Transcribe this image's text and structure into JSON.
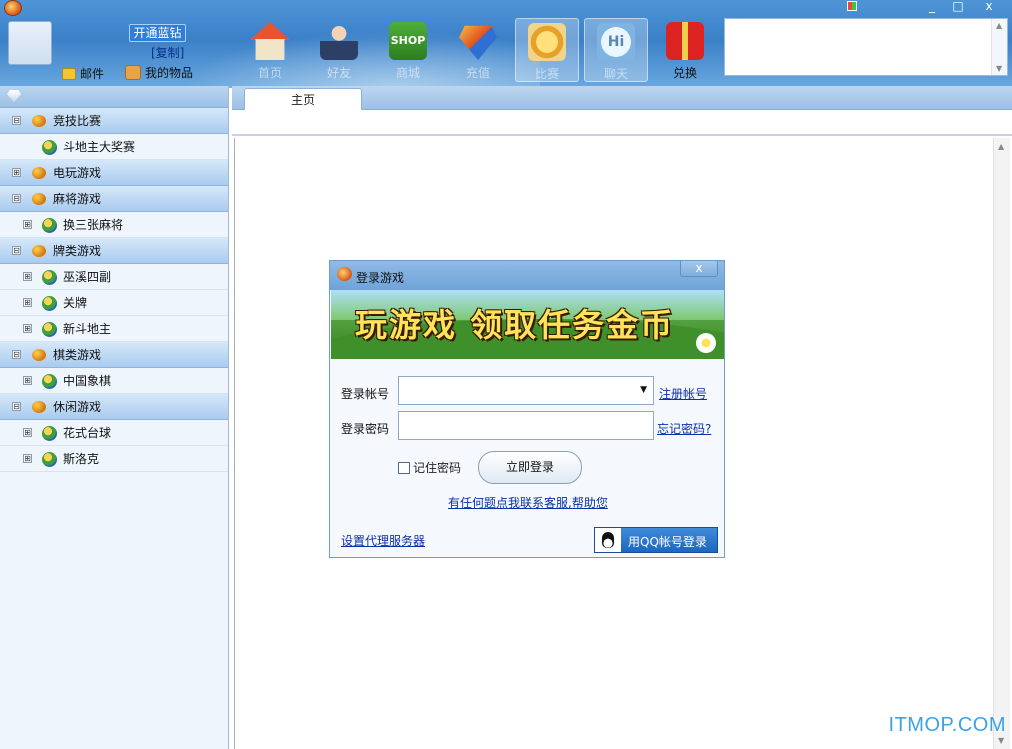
{
  "topbar": {
    "vip_label": "开通蓝钻",
    "copy_label": "[复制]",
    "mail_label": "邮件",
    "items_label": "我的物品",
    "tools": [
      {
        "label": "首页",
        "icon": "home-icon"
      },
      {
        "label": "好友",
        "icon": "friend-icon"
      },
      {
        "label": "商城",
        "icon": "shop-icon",
        "icon_text": "SHOP"
      },
      {
        "label": "充值",
        "icon": "pay-icon"
      },
      {
        "label": "比赛",
        "icon": "medal-icon"
      },
      {
        "label": "聊天",
        "icon": "chat-icon",
        "icon_text": "Hi"
      },
      {
        "label": "兑换",
        "icon": "gift-icon"
      }
    ]
  },
  "window": {
    "minimize": "_",
    "maximize": "□",
    "close": "x"
  },
  "sidebar": {
    "tree": [
      {
        "label": "竞技比赛",
        "toggle": "⊟"
      },
      {
        "label": "斗地主大奖赛"
      },
      {
        "label": "电玩游戏",
        "toggle": "⊞"
      },
      {
        "label": "麻将游戏",
        "toggle": "⊟"
      },
      {
        "label": "换三张麻将",
        "toggle": "⊞"
      },
      {
        "label": "牌类游戏",
        "toggle": "⊟"
      },
      {
        "label": "巫溪四副",
        "toggle": "⊞"
      },
      {
        "label": "关牌",
        "toggle": "⊞"
      },
      {
        "label": "新斗地主",
        "toggle": "⊞"
      },
      {
        "label": "棋类游戏",
        "toggle": "⊟"
      },
      {
        "label": "中国象棋",
        "toggle": "⊞"
      },
      {
        "label": "休闲游戏",
        "toggle": "⊟"
      },
      {
        "label": "花式台球",
        "toggle": "⊞"
      },
      {
        "label": "斯洛克",
        "toggle": "⊞"
      }
    ]
  },
  "main": {
    "tab_label": "主页",
    "watermark": "ITMOP.COM"
  },
  "dialog": {
    "title": "登录游戏",
    "close": "x",
    "banner_text": "玩游戏 领取任务金币",
    "account_label": "登录帐号",
    "account_value": "",
    "register_link": "注册帐号",
    "password_label": "登录密码",
    "password_value": "",
    "forgot_link": "忘记密码?",
    "remember_label": "记住密码",
    "login_button": "立即登录",
    "help_link": "有任何题点我联系客服,帮助您",
    "proxy_link": "设置代理服务器",
    "qq_button": "用QQ帐号登录"
  },
  "colors": {
    "accent": "#3b80c8",
    "link": "#0a2fa6",
    "watermark": "#3ba3e3",
    "qq_button": "#1d67c0"
  }
}
